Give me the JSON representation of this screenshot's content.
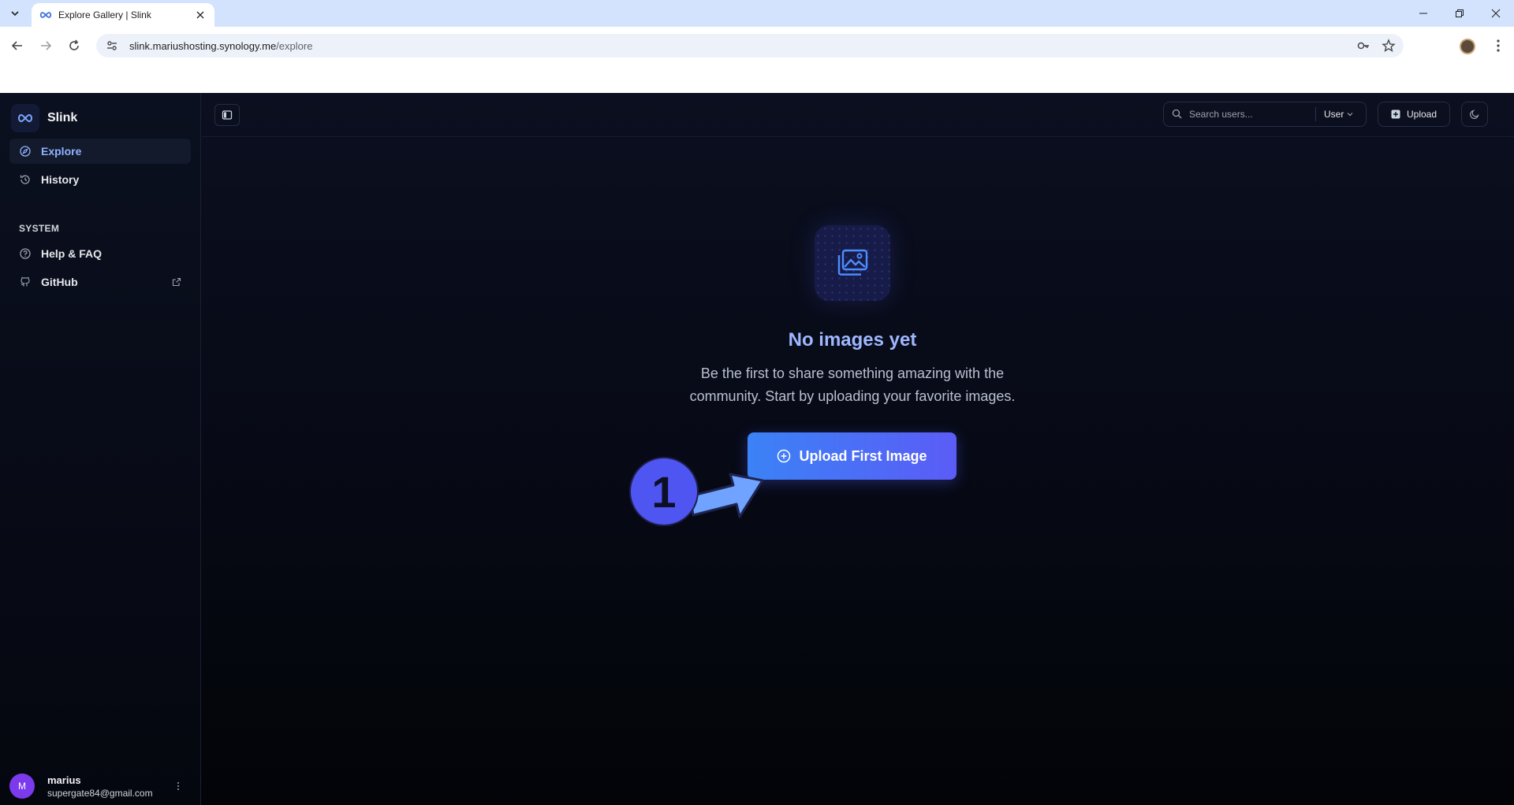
{
  "browser": {
    "tab_title": "Explore Gallery | Slink",
    "url_host": "slink.mariushosting.synology.me",
    "url_path": "/explore"
  },
  "sidebar": {
    "brand": "Slink",
    "items": [
      {
        "label": "Explore",
        "icon": "compass-icon",
        "active": true
      },
      {
        "label": "History",
        "icon": "history-icon"
      }
    ],
    "section_label": "SYSTEM",
    "system_items": [
      {
        "label": "Help & FAQ",
        "icon": "help-circle-icon"
      },
      {
        "label": "GitHub",
        "icon": "github-icon"
      }
    ],
    "user": {
      "initial": "M",
      "name": "marius",
      "email": "supergate84@gmail.com"
    }
  },
  "topbar": {
    "search_placeholder": "Search users...",
    "filter_label": "User",
    "upload_label": "Upload"
  },
  "empty_state": {
    "title": "No images yet",
    "description_line1": "Be the first to share something amazing with the",
    "description_line2": "community. Start by uploading your favorite images.",
    "cta_label": "Upload First Image"
  },
  "annotation": {
    "step": "1"
  },
  "colors": {
    "accent": "#3b82f6",
    "accent_end": "#5b5cf6",
    "badge": "#4f55f0",
    "arrow": "#6fa3ff"
  }
}
